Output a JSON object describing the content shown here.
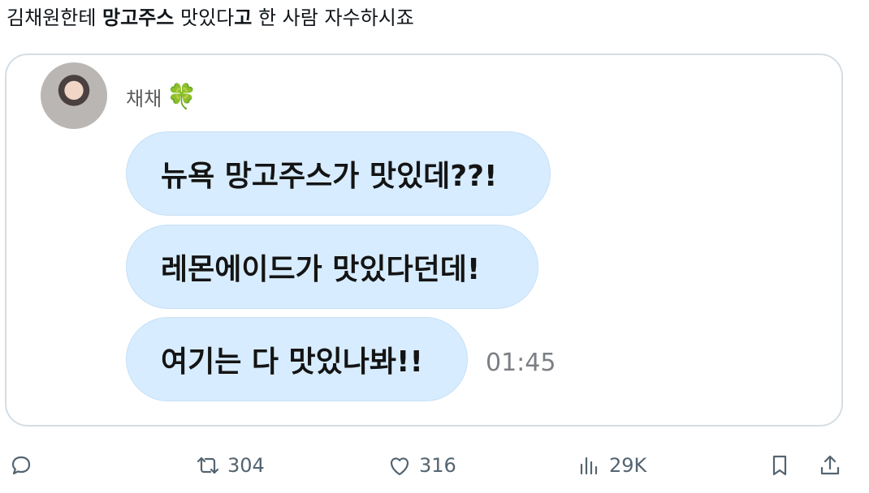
{
  "tweet": {
    "text_part1": "김채원한테 ",
    "text_bold1": "망고주스",
    "text_part2": " 맛있다",
    "text_bold2": "고",
    "text_part3": " 한 사람 자수하시죠"
  },
  "chat": {
    "sender_name": "채채",
    "sender_emoji": "🍀",
    "messages": [
      "뉴욕 망고주스가 맛있데??!",
      "레몬에이드가 맛있다던데!",
      "여기는 다 맛있나봐!!"
    ],
    "timestamp": "01:45"
  },
  "actions": {
    "reply_count": "",
    "retweet_count": "304",
    "like_count": "316",
    "views_count": "29K"
  }
}
